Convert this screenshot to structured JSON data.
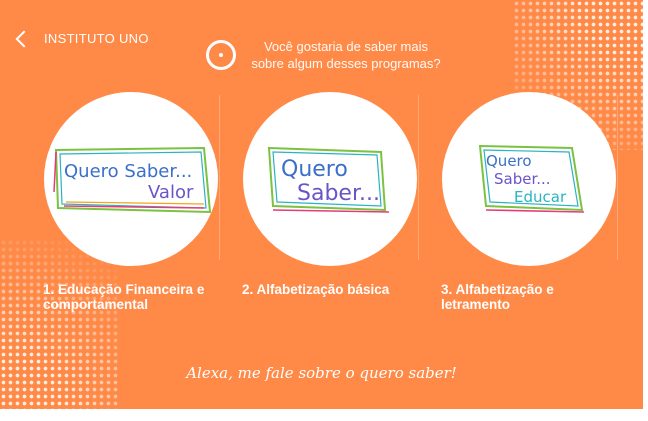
{
  "header": {
    "back_label": "INSTITUTO UNO",
    "prompt_line1": "Você gostaria de saber mais",
    "prompt_line2": "sobre algum desses programas?"
  },
  "cards": [
    {
      "title": "1. Educação Financeira e comportamental",
      "logo": {
        "line1": "Quero Saber...",
        "line2": "Valor",
        "line3": ""
      }
    },
    {
      "title": "2. Alfabetização básica",
      "logo": {
        "line1": "Quero",
        "line2": "Saber...",
        "line3": ""
      }
    },
    {
      "title": "3. Alfabetização e letramento",
      "logo": {
        "line1": "Quero",
        "line2": "Saber...",
        "line3": "Educar"
      }
    }
  ],
  "footer": {
    "hint": "Alexa, me fale sobre o quero saber!"
  },
  "colors": {
    "background": "#ff8a48",
    "text": "#ffffff",
    "logo_letters": [
      "#3b6fc9",
      "#e63b7a",
      "#2bb3c0",
      "#7cc242",
      "#f2a516",
      "#9b4fc8"
    ]
  },
  "icons": [
    "chevron-left-icon",
    "alexa-ring-icon"
  ]
}
